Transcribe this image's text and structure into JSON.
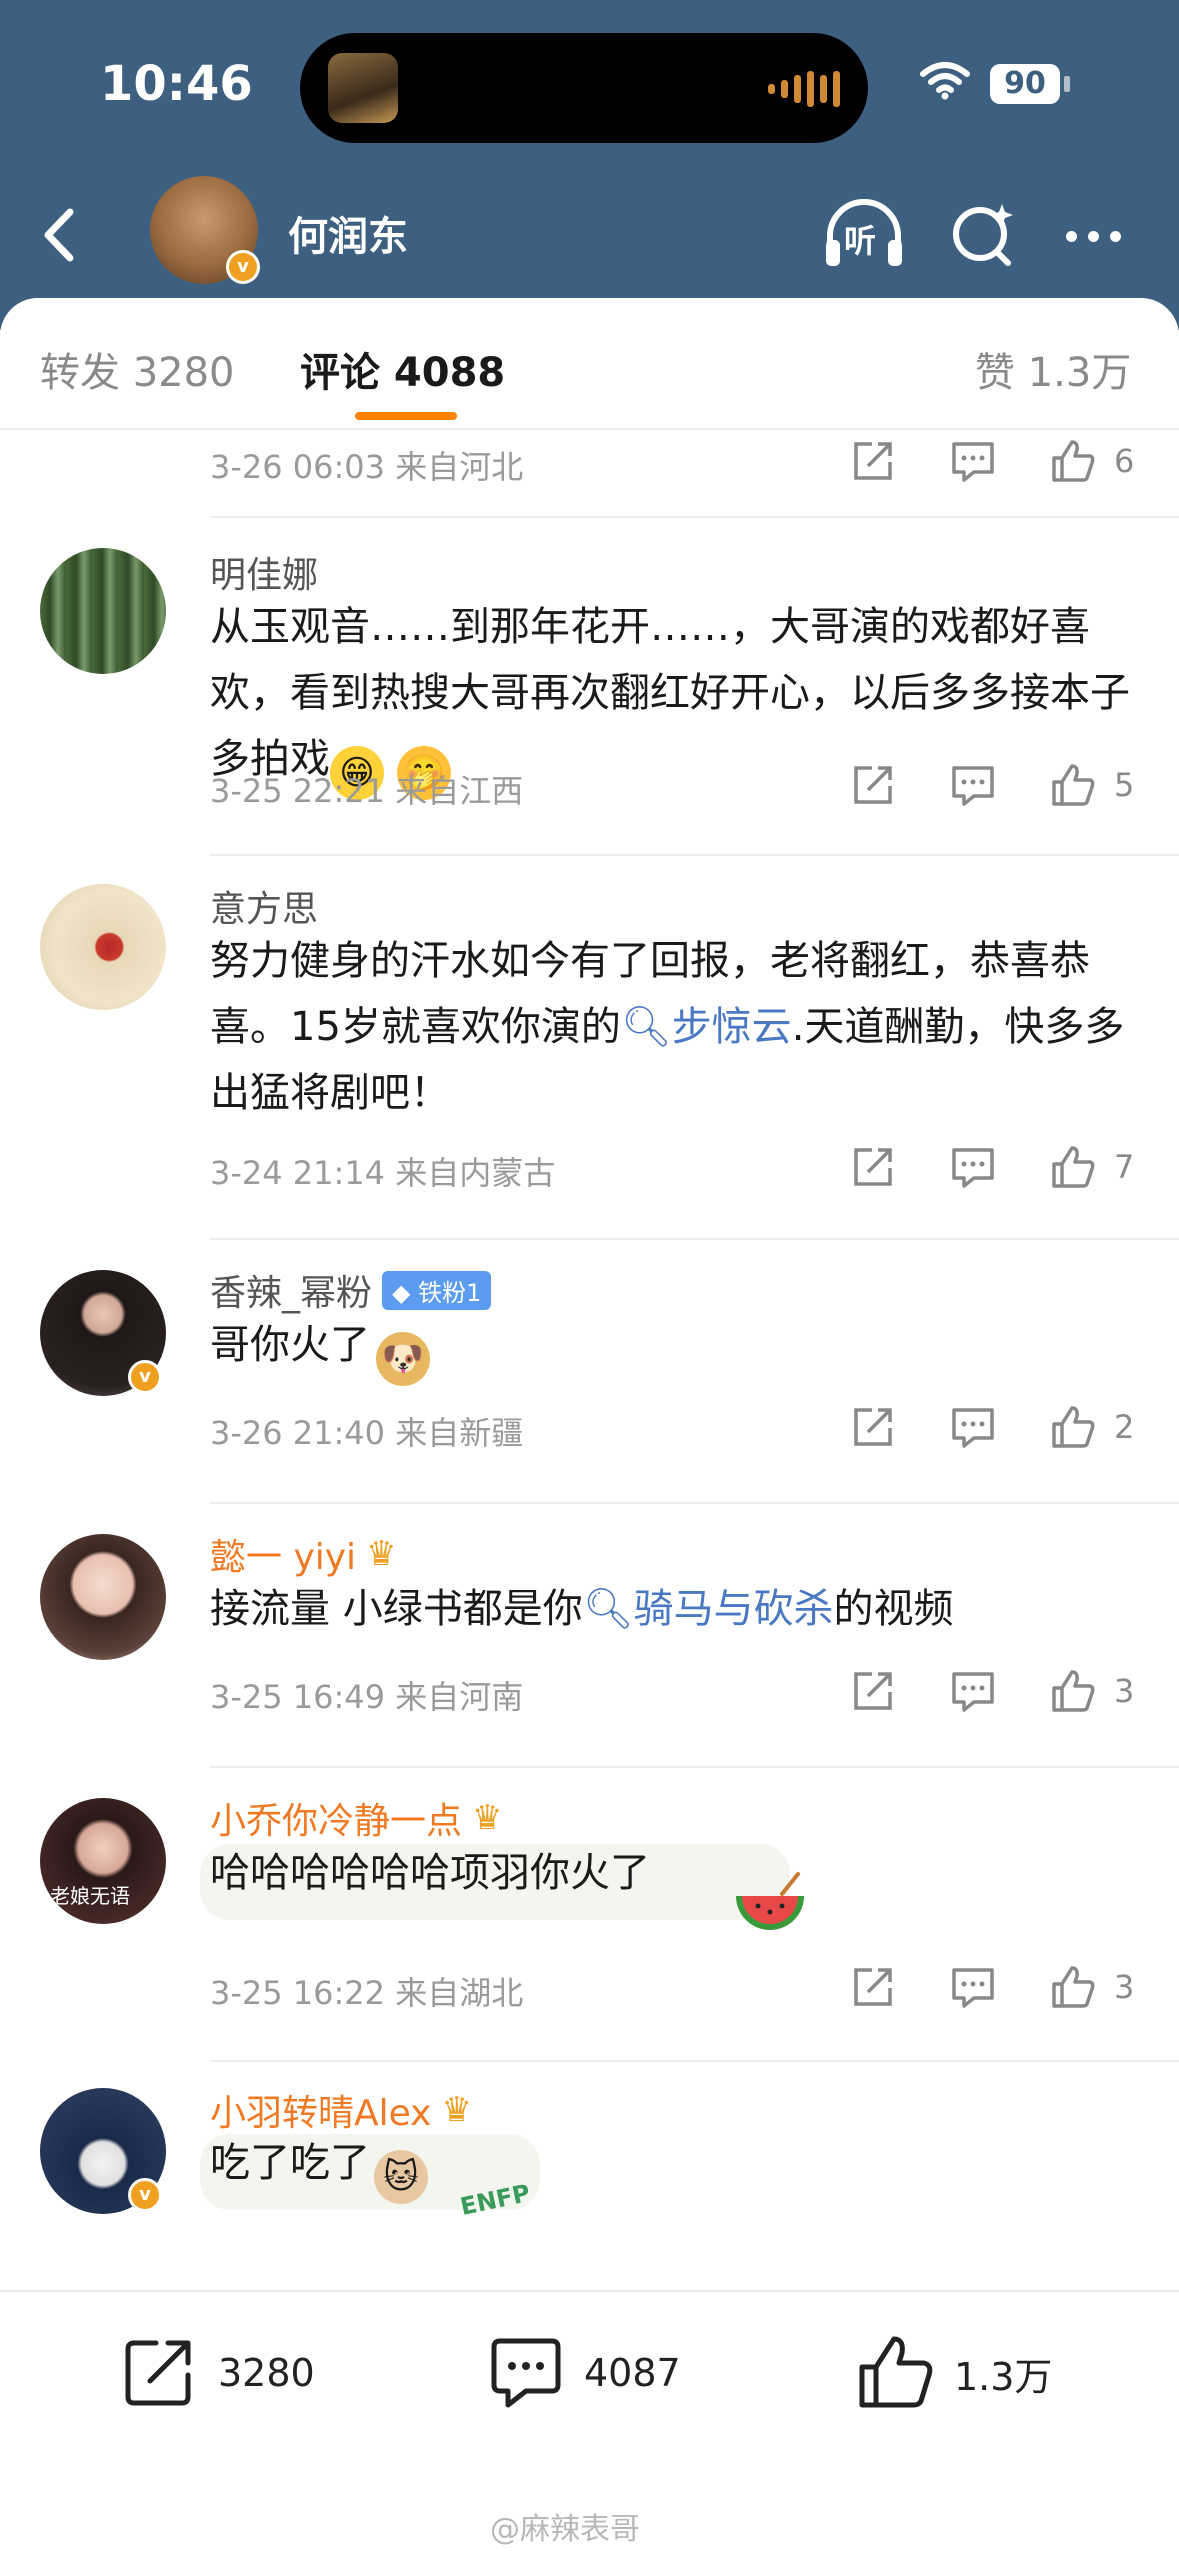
{
  "status": {
    "time": "10:46",
    "battery": "90"
  },
  "nav": {
    "title": "何润东",
    "listen_label": "听"
  },
  "tabs": {
    "repost": "转发 3280",
    "comment": "评论 4088",
    "like": "赞 1.3万"
  },
  "comments": [
    {
      "meta": "3-26 06:03  来自河北",
      "likes": "6"
    },
    {
      "name": "明佳娜",
      "text": "从玉观音……到那年花开……，大哥演的戏都好喜欢，看到热搜大哥再次翻红好开心，以后多多接本子多拍戏",
      "meta": "3-25 22:21  来自江西",
      "likes": "5"
    },
    {
      "name": "意方思",
      "text_1": "努力健身的汗水如今有了回报，老将翻红，恭喜恭喜。15岁就喜欢你演的",
      "topic": "步惊云",
      "text_2": ".天道酬勤，快多多出猛将剧吧！",
      "meta": "3-24 21:14  来自内蒙古",
      "likes": "7"
    },
    {
      "name": "香辣_幂粉",
      "badge": "铁粉1",
      "text": "哥你火了",
      "meta": "3-26 21:40  来自新疆",
      "likes": "2"
    },
    {
      "name": "懿一 yiyi",
      "text_1": "接流量 小绿书都是你",
      "topic": "骑马与砍杀",
      "text_2": "的视频",
      "meta": "3-25 16:49  来自河南",
      "likes": "3"
    },
    {
      "name": "小乔你冷静一点",
      "avatar_text": "老娘无语",
      "text": "哈哈哈哈哈哈项羽你火了",
      "meta": "3-25 16:22  来自湖北",
      "likes": "3"
    },
    {
      "name": "小羽转晴Alex",
      "text": "吃了吃了",
      "sticker": "ENFP"
    }
  ],
  "bottom": {
    "repost": "3280",
    "comment": "4087",
    "like": "1.3万"
  },
  "watermark": "@麻辣表哥",
  "colors": {
    "header": "#3d5f80",
    "accent": "#ff8200",
    "topic": "#4a78c2",
    "vip_name": "#ef7a23"
  }
}
